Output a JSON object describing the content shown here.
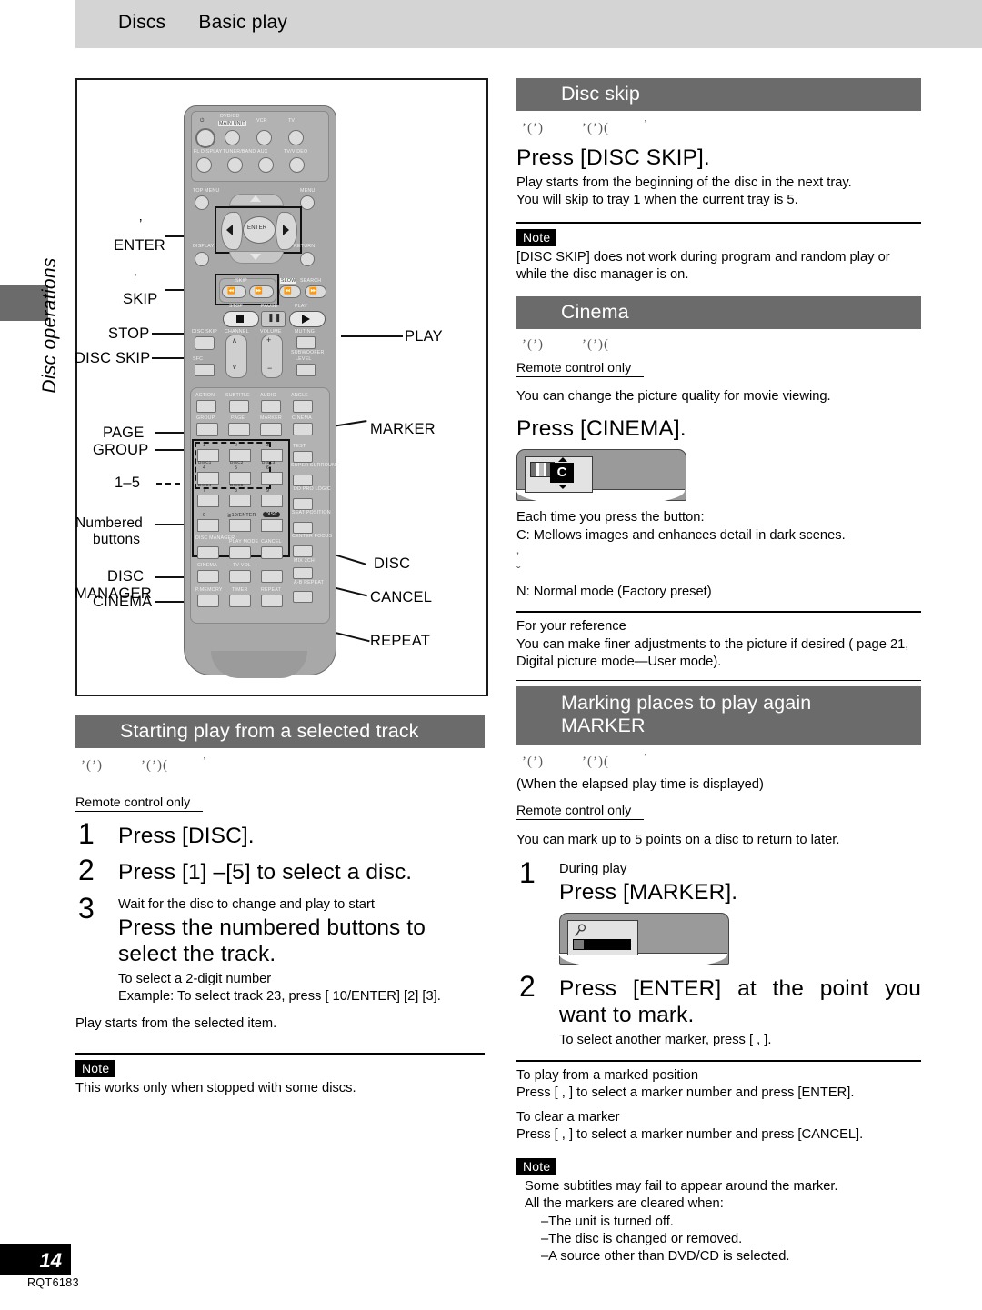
{
  "running_head": {
    "left": "Discs",
    "right": "Basic play"
  },
  "thumb_tab_label": "Disc operations",
  "page": {
    "number": "14",
    "code": "RQT6183"
  },
  "remote_callouts": {
    "left": [
      {
        "name": "enter",
        "tick": "’",
        "label": "ENTER"
      },
      {
        "name": "skip",
        "tick": "’",
        "label": "SKIP"
      },
      {
        "name": "stop",
        "label": "STOP"
      },
      {
        "name": "disc-skip",
        "label": "DISC SKIP"
      },
      {
        "name": "page",
        "label": "PAGE"
      },
      {
        "name": "group",
        "label": "GROUP"
      },
      {
        "name": "one-to-five",
        "label": "1–5"
      },
      {
        "name": "numbered-buttons",
        "label": "Numbered"
      },
      {
        "name": "numbered-buttons-2",
        "label": "buttons"
      },
      {
        "name": "disc-manager",
        "label": "DISC"
      },
      {
        "name": "disc-manager-2",
        "label": "MANAGER"
      },
      {
        "name": "cinema",
        "label": "CINEMA"
      }
    ],
    "right": [
      {
        "name": "play",
        "label": "PLAY"
      },
      {
        "name": "marker",
        "label": "MARKER"
      },
      {
        "name": "disc",
        "label": "DISC"
      },
      {
        "name": "cancel",
        "label": "CANCEL"
      },
      {
        "name": "repeat",
        "label": "REPEAT"
      }
    ]
  },
  "remote_face": {
    "row_power": [
      "DVD/CD",
      "MAIN UNIT",
      "VCR",
      "TV"
    ],
    "row_source": [
      "FL DISPLAY",
      "TUNER/BAND",
      "AUX",
      "TV/VIDEO"
    ],
    "menus": [
      "TOP MENU",
      "MENU"
    ],
    "nav_center": "ENTER",
    "nav_sides": [
      "DISPLAY",
      "RETURN"
    ],
    "skip_label": "SKIP",
    "search_label": "SLOW/SEARCH",
    "transport": [
      "STOP",
      "PAUSE",
      "PLAY"
    ],
    "row_misc": [
      "DISC SKIP",
      "CHANNEL",
      "VOLUME",
      "MUTING"
    ],
    "row_misc2": [
      "SFC",
      "SUBWOOFER",
      "LEVEL"
    ],
    "row_av": [
      "ACTION",
      "SUBTITLE",
      "AUDIO",
      "ANGLE"
    ],
    "row_gpm": [
      "GROUP",
      "PAGE",
      "MARKER",
      "CINEMA"
    ],
    "keypad": [
      "1",
      "2",
      "3",
      "4",
      "5",
      "6",
      "7",
      "8",
      "9",
      "0",
      "≧10/ENTER",
      "DISC"
    ],
    "keypad_sub": [
      "DISC1",
      "DISC2",
      "DISC3",
      "DISC4",
      "DISC5"
    ],
    "right_col": [
      "TEST",
      "SUPER SURROUND",
      "DD PRO LOGIC",
      "SEAT POSITION",
      "CENTER FOCUS",
      "MIX 2CH",
      "A-B REPEAT"
    ],
    "bottom_rows": [
      "DISC MANAGER",
      "PLAY MODE",
      "CANCEL",
      "CINEMA",
      "TV VOL",
      "P.MEMORY",
      "TIMER",
      "REPEAT"
    ]
  },
  "left_column": {
    "section_title": "Starting play from a selected track",
    "disc_icons": [
      "’(’)",
      "’(’)(",
      "’"
    ],
    "remote_only": "Remote control only",
    "steps": [
      {
        "n": "1",
        "heading": "Press [DISC]."
      },
      {
        "n": "2",
        "heading": "Press [1] –[5] to select a disc."
      },
      {
        "n": "3",
        "pre": "Wait for the disc to change and play to start",
        "heading": "Press the numbered buttons to select the track.",
        "sub1": "To select a 2-digit number",
        "sub2": "Example: To select track 23, press [  10/ENTER]   [2]   [3]."
      }
    ],
    "after": "Play starts from the selected item.",
    "note_label": "Note",
    "note_text": "This works only when stopped with some discs."
  },
  "right_column": {
    "disc_skip": {
      "title": "Disc skip",
      "disc_icons": [
        "’(’)",
        "’(’)(",
        "’"
      ],
      "heading": "Press [DISC SKIP].",
      "lines": [
        "Play starts from the beginning of the disc in the next tray.",
        "You will skip to tray 1 when the current tray is 5."
      ],
      "note_label": "Note",
      "note_text": "[DISC SKIP] does not work during program and random play or while the disc manager is on."
    },
    "cinema": {
      "title": "Cinema",
      "disc_icons": [
        "’(’)",
        "’(’)("
      ],
      "remote_only": "Remote control only",
      "intro": "You can change the picture quality for movie viewing.",
      "heading": "Press [CINEMA].",
      "osd_letter": "C",
      "lines": [
        "Each time you press the button:",
        "C: Mellows images and enhances detail in dark scenes."
      ],
      "arrow_glyphs": [
        "’",
        "ˇ"
      ],
      "normal_line": "N: Normal mode (Factory preset)",
      "ref_label": "For your reference",
      "ref_text": "You can make finer adjustments to the picture if desired (   page 21, Digital picture mode—User mode)."
    },
    "marker": {
      "title_line1": "Marking places to play again",
      "title_line2": "MARKER",
      "disc_icons": [
        "’(’)",
        "’(’)(",
        "’"
      ],
      "condition": "(When the elapsed play time is displayed)",
      "remote_only": "Remote control only",
      "intro": "You can mark up to 5 points on a disc to return to later.",
      "steps": [
        {
          "n": "1",
          "pre": "During play",
          "heading": "Press [MARKER]."
        },
        {
          "n": "2",
          "heading": "Press [ENTER] at the point you want to mark.",
          "sub": "To select another marker, press [   ,    ]."
        }
      ],
      "play_from_label": "To play from a marked position",
      "play_from_text": "Press [   ,    ] to select a marker number and press [ENTER].",
      "clear_label": "To clear a marker",
      "clear_text": "Press [   ,    ] to select a marker number and press [CANCEL].",
      "note_label": "Note",
      "note_lines": [
        "Some subtitles may fail to appear around the marker.",
        "All the markers are cleared when:",
        "–The unit is turned off.",
        "–The disc is changed or removed.",
        "–A source other than DVD/CD is selected."
      ]
    }
  },
  "colors": {
    "header_bar": "#6b6b6b",
    "running_head": "#d4d4d4",
    "ink": "#000000"
  }
}
